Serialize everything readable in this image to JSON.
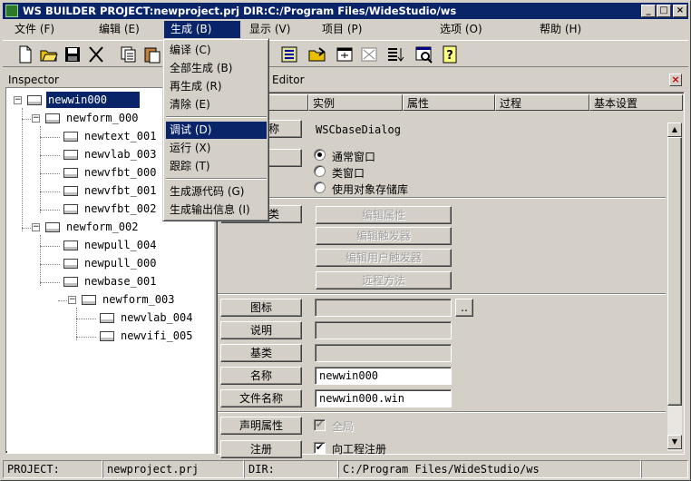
{
  "title": "WS BUILDER PROJECT:newproject.prj DIR:C:/Program Files/WideStudio/ws",
  "menubar": [
    "文件 (F)",
    "编辑 (E)",
    "生成 (B)",
    "显示 (V)",
    "项目 (P)",
    "选项 (O)",
    "帮助 (H)"
  ],
  "build_menu": {
    "items": [
      "编译 (C)",
      "全部生成 (B)",
      "再生成 (R)",
      "清除 (E)",
      "调试 (D)",
      "运行 (X)",
      "跟踪 (T)",
      "生成源代码 (G)",
      "生成输出信息 (I)"
    ],
    "highlighted": "调试 (D)"
  },
  "inspector": {
    "title": "Inspector",
    "tree": [
      "newwin000",
      "newform_000",
      "newtext_001",
      "newvlab_003",
      "newvfbt_000",
      "newvfbt_001",
      "newvfbt_002",
      "newform_002",
      "newpull_004",
      "newpull_000",
      "newbase_001",
      "newform_003",
      "newvlab_004",
      "newvifi_005"
    ],
    "selected": "newwin000"
  },
  "editor": {
    "title": "Editor",
    "tabs": [
      "实例",
      "属性",
      "过程",
      "基本设置"
    ],
    "class_label": "称",
    "class_value": "WSCbaseDialog",
    "radio_options": [
      "通常窗口",
      "类窗口",
      "使用对象存储库"
    ],
    "radio_selected": "通常窗口",
    "type_label": "类",
    "disabled_buttons": [
      "编辑属性",
      "编辑触发器",
      "编辑用户触发器",
      "远程方法"
    ],
    "fields": [
      {
        "label": "图标",
        "value": ""
      },
      {
        "label": "说明",
        "value": ""
      },
      {
        "label": "基类",
        "value": ""
      },
      {
        "label": "名称",
        "value": "newwin000"
      },
      {
        "label": "文件名称",
        "value": "newwin000.win"
      }
    ],
    "browse_label": "..",
    "declare_label": "声明属性",
    "declare_check_label": "全局",
    "register_label": "注册",
    "register_check_label": "向工程注册"
  },
  "status": {
    "project_label": "PROJECT:",
    "project_value": "newproject.prj",
    "dir_label": "DIR:",
    "dir_value": "C:/Program Files/WideStudio/ws"
  }
}
